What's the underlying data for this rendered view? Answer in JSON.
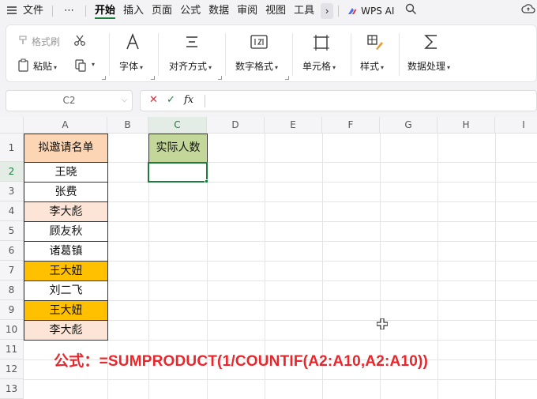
{
  "menu": {
    "file": "文件",
    "more": "⋯",
    "tabs": [
      "开始",
      "插入",
      "页面",
      "公式",
      "数据",
      "审阅",
      "视图",
      "工具"
    ],
    "active_tab": "开始",
    "overflow": "›",
    "wps_ai": "WPS AI"
  },
  "ribbon": {
    "format_painter": "格式刷",
    "paste": "粘贴",
    "font": "字体",
    "align": "对齐方式",
    "number_format": "数字格式",
    "cell": "单元格",
    "style": "样式",
    "data_process": "数据处理"
  },
  "formula_bar": {
    "name_box": "C2",
    "cancel": "✕",
    "confirm": "✓",
    "fx": "fx",
    "value": ""
  },
  "sheet": {
    "columns": [
      "A",
      "B",
      "C",
      "D",
      "E",
      "F",
      "G",
      "H",
      "I"
    ],
    "rows": [
      "1",
      "2",
      "3",
      "4",
      "5",
      "6",
      "7",
      "8",
      "9",
      "10",
      "11",
      "12",
      "13"
    ],
    "a1": "拟邀请名单",
    "c1": "实际人数",
    "names": [
      "王晓",
      "张费",
      "李大彪",
      "顾友秋",
      "诸葛镇",
      "王大妞",
      "刘二飞",
      "王大妞",
      "李大彪"
    ],
    "name_fills": [
      "#ffffff",
      "#ffffff",
      "#fce4d6",
      "#ffffff",
      "#ffffff",
      "#ffc000",
      "#ffffff",
      "#ffc000",
      "#fce4d6"
    ],
    "header_fill_a1": "#fcd5b4",
    "header_fill_c1": "#c4d79b",
    "selected_cell": "C2"
  },
  "annotation": "公式：=SUMPRODUCT(1/COUNTIF(A2:A10,A2:A10))",
  "colors": {
    "accent": "#1f7a3f",
    "annotation": "#e8262c"
  }
}
